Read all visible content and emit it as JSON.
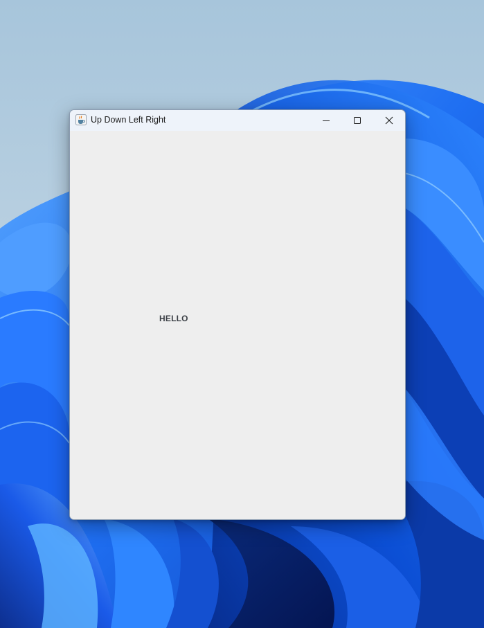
{
  "window": {
    "title": "Up Down Left Right",
    "icon": "java-coffee-cup-icon"
  },
  "controls": {
    "minimize_icon": "minimize-icon",
    "maximize_icon": "maximize-icon",
    "close_icon": "close-icon"
  },
  "content": {
    "label": "HELLO"
  },
  "colors": {
    "wallpaper_blue": "#1a6ef5",
    "window_background": "#eeeeee",
    "titlebar_background": "#eef3fa",
    "label_color": "#3b3f45"
  }
}
